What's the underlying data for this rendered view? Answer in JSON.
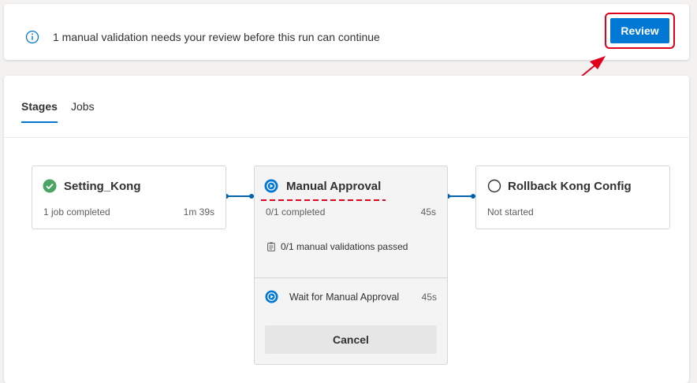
{
  "banner": {
    "message": "1 manual validation needs your review before this run can continue",
    "review_label": "Review",
    "icon": "info-icon"
  },
  "tabs": [
    {
      "label": "Stages",
      "selected": true
    },
    {
      "label": "Jobs",
      "selected": false
    }
  ],
  "stages": [
    {
      "name": "Setting_Kong",
      "status": "succeeded",
      "status_icon": "check-circle-icon",
      "summary": "1 job completed",
      "duration": "1m 39s"
    },
    {
      "name": "Manual Approval",
      "status": "waiting",
      "status_icon": "play-circle-icon",
      "summary": "0/1 completed",
      "duration": "45s",
      "validation_text": "0/1 manual validations passed",
      "validation_icon": "clipboard-icon",
      "job": {
        "name": "Wait for Manual Approval",
        "duration": "45s",
        "status_icon": "play-circle-icon"
      },
      "cancel_label": "Cancel"
    },
    {
      "name": "Rollback Kong Config",
      "status": "not-started",
      "status_icon": "circle-outline-icon",
      "summary": "Not started",
      "duration": ""
    }
  ],
  "colors": {
    "accent": "#0078d4",
    "success": "#4aa564",
    "highlight_red": "#e0001b",
    "connector": "#0062ad"
  }
}
